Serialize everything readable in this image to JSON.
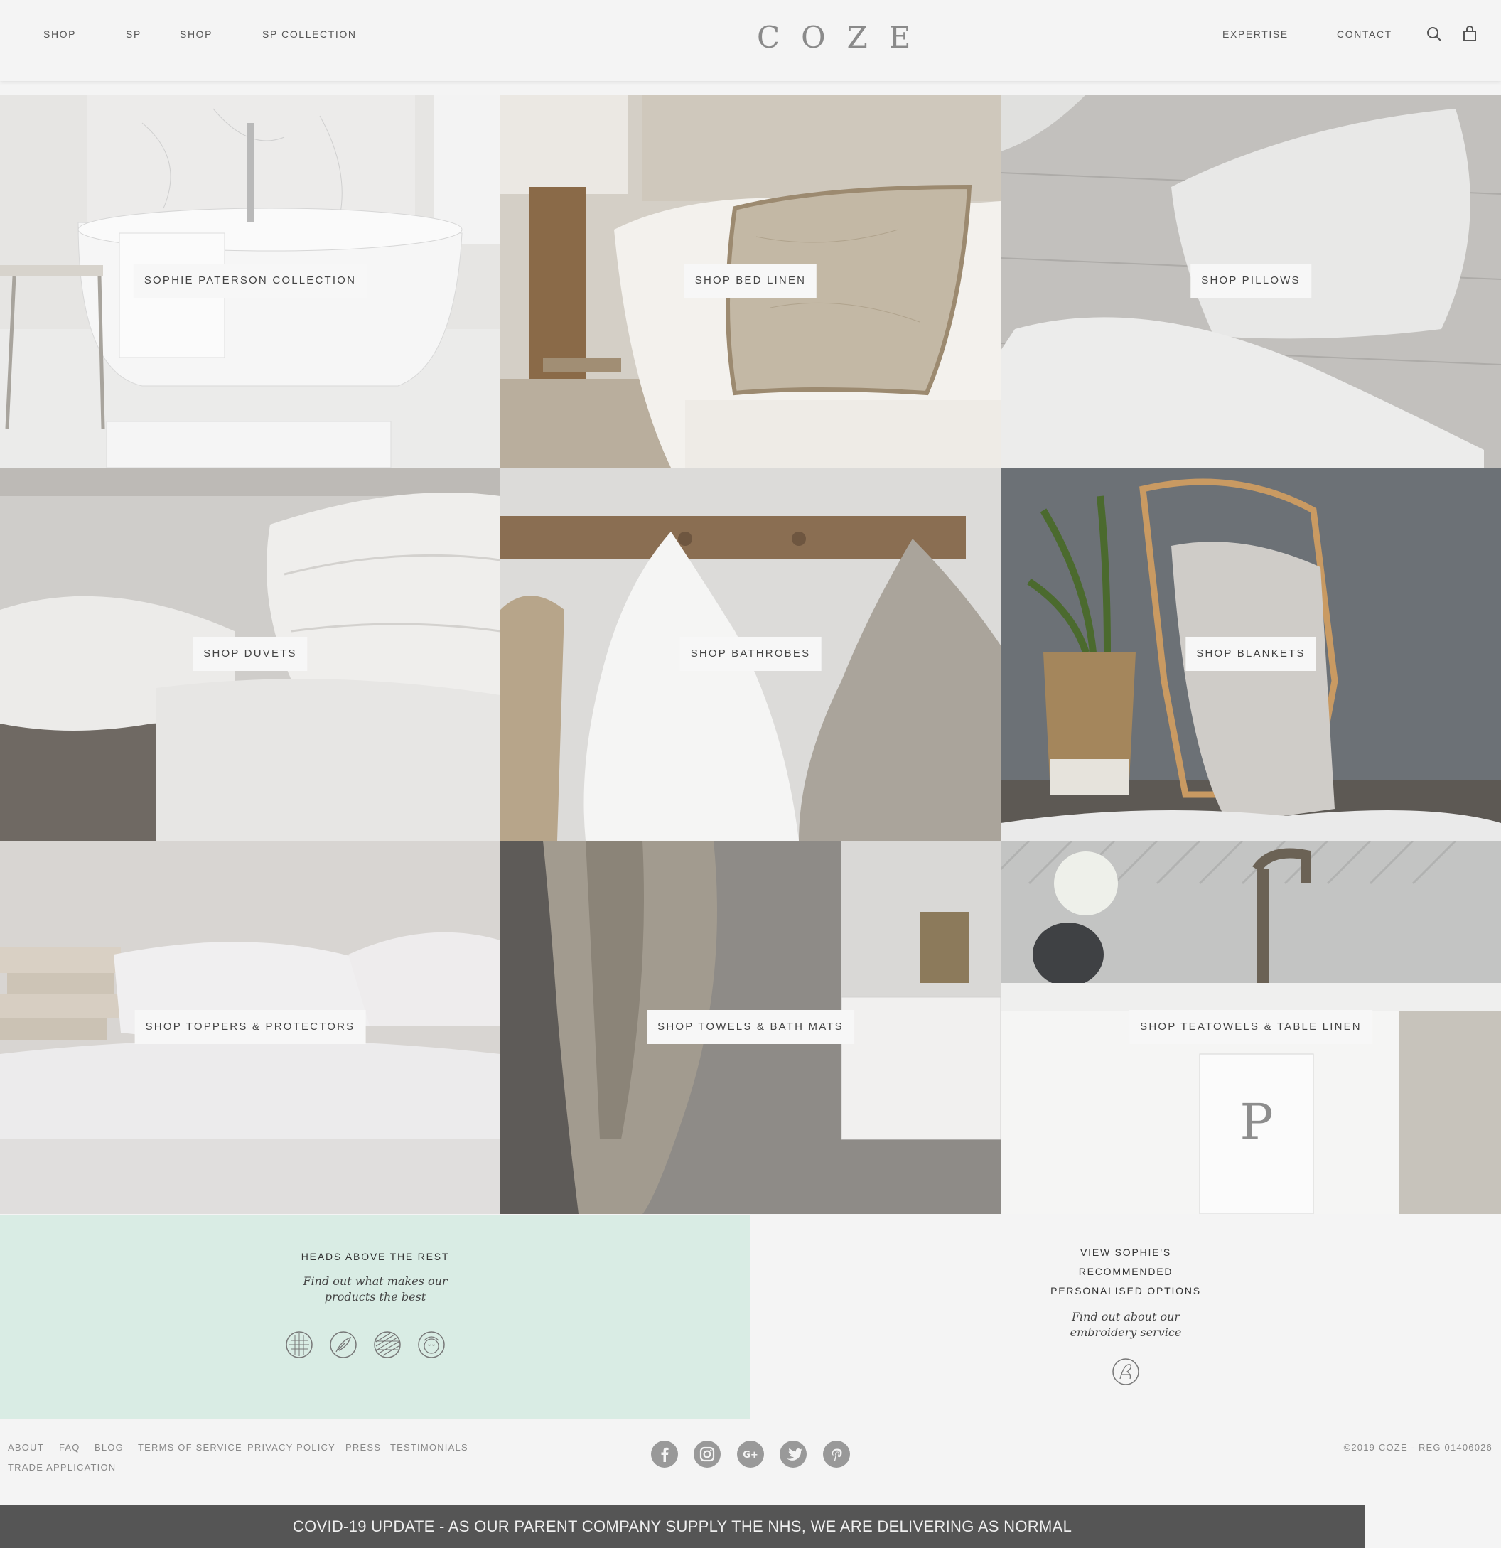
{
  "header": {
    "logo": "COZE",
    "nav_left": [
      "SHOP",
      "SP",
      "SHOP",
      "SP COLLECTION"
    ],
    "nav_right": [
      "EXPERTISE",
      "CONTACT"
    ]
  },
  "tiles": [
    {
      "label": "SOPHIE PATERSON COLLECTION"
    },
    {
      "label": "SHOP BED LINEN"
    },
    {
      "label": "SHOP PILLOWS"
    },
    {
      "label": "SHOP DUVETS"
    },
    {
      "label": "SHOP BATHROBES"
    },
    {
      "label": "SHOP BLANKETS"
    },
    {
      "label": "SHOP TOPPERS & PROTECTORS"
    },
    {
      "label": "SHOP TOWELS & BATH MATS"
    },
    {
      "label": "SHOP TEATOWELS & TABLE LINEN"
    }
  ],
  "promo_left": {
    "heading": "HEADS ABOVE THE REST",
    "sub_line1": "Find out what makes our",
    "sub_line2": "products the best",
    "icons": [
      "fabric-weave-icon",
      "feather-down-icon",
      "thread-count-icon",
      "sleeping-face-icon"
    ]
  },
  "promo_right": {
    "heading_line1": "VIEW SOPHIE'S",
    "heading_line2": "RECOMMENDED",
    "heading_line3": "PERSONALISED OPTIONS",
    "sub_line1": "Find out about our",
    "sub_line2": "embroidery service",
    "icon": "monogram-icon"
  },
  "footer": {
    "links_row1": [
      "ABOUT",
      "FAQ",
      "BLOG",
      "TERMS OF SERVICE",
      "PRIVACY POLICY",
      "PRESS",
      "TESTIMONIALS"
    ],
    "links_row2": [
      "TRADE APPLICATION"
    ],
    "social": [
      "facebook-icon",
      "instagram-icon",
      "google-plus-icon",
      "twitter-icon",
      "pinterest-icon"
    ],
    "copyright": "©2019 COZE - REG 01406026"
  },
  "banner": {
    "text": "COVID-19 UPDATE - AS OUR PARENT COMPANY SUPPLY THE NHS, WE ARE DELIVERING AS NORMAL"
  },
  "colors": {
    "promo_mint": "#d9ece4",
    "banner_bg": "#555555",
    "page_bg": "#f4f4f4"
  }
}
